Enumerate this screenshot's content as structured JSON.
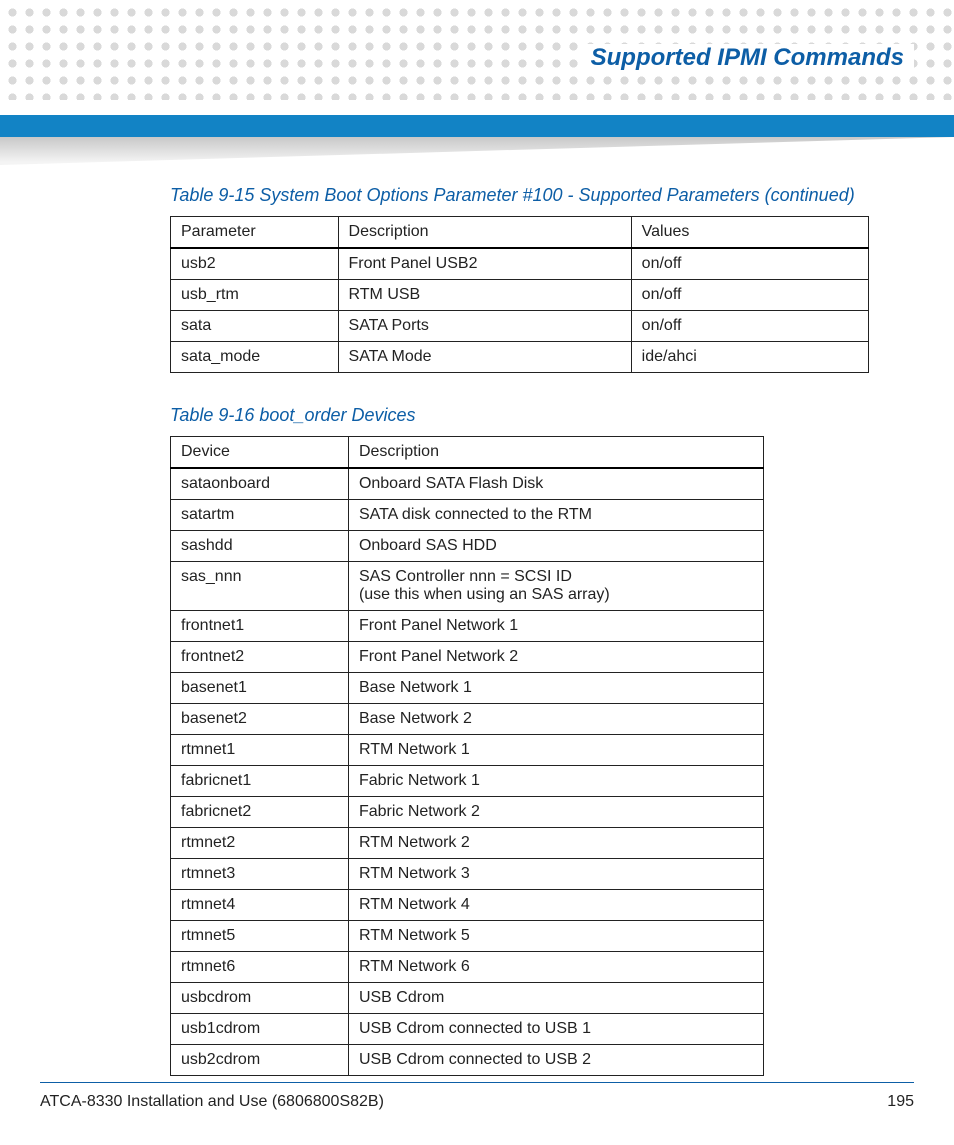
{
  "header": {
    "title": "Supported IPMI Commands"
  },
  "table_9_15": {
    "caption": "Table 9-15 System Boot Options Parameter #100 - Supported Parameters  (continued)",
    "headers": {
      "c0": "Parameter",
      "c1": "Description",
      "c2": "Values"
    },
    "rows": [
      {
        "c0": "usb2",
        "c1": "Front Panel USB2",
        "c2": "on/off"
      },
      {
        "c0": "usb_rtm",
        "c1": "RTM USB",
        "c2": "on/off"
      },
      {
        "c0": " sata",
        "c1": "SATA Ports",
        "c2": "on/off"
      },
      {
        "c0": "sata_mode",
        "c1": "SATA Mode",
        "c2": "ide/ahci"
      }
    ]
  },
  "table_9_16": {
    "caption": "Table 9-16 boot_order Devices",
    "headers": {
      "c0": "Device",
      "c1": "Description"
    },
    "rows": [
      {
        "c0": "sataonboard",
        "c1": "Onboard SATA Flash Disk"
      },
      {
        "c0": "satartm",
        "c1": "SATA disk connected to the RTM"
      },
      {
        "c0": "sashdd",
        "c1": "Onboard SAS HDD"
      },
      {
        "c0": "sas_nnn",
        "c1": "SAS Controller nnn = SCSI ID\n(use this when using an SAS array)"
      },
      {
        "c0": "frontnet1",
        "c1": "Front Panel Network 1"
      },
      {
        "c0": "frontnet2",
        "c1": "Front Panel Network 2"
      },
      {
        "c0": "basenet1",
        "c1": "Base Network 1"
      },
      {
        "c0": "basenet2",
        "c1": "Base Network 2"
      },
      {
        "c0": " rtmnet1",
        "c1": "RTM Network 1"
      },
      {
        "c0": "fabricnet1",
        "c1": "Fabric Network 1"
      },
      {
        "c0": "fabricnet2",
        "c1": "Fabric Network 2"
      },
      {
        "c0": "rtmnet2",
        "c1": "RTM Network 2"
      },
      {
        "c0": "rtmnet3",
        "c1": "RTM Network 3"
      },
      {
        "c0": "rtmnet4",
        "c1": "RTM Network 4"
      },
      {
        "c0": "rtmnet5",
        "c1": "RTM Network 5"
      },
      {
        "c0": "rtmnet6",
        "c1": "RTM Network 6"
      },
      {
        "c0": "usbcdrom",
        "c1": "USB Cdrom"
      },
      {
        "c0": "usb1cdrom",
        "c1": "USB Cdrom connected to USB 1"
      },
      {
        "c0": "usb2cdrom",
        "c1": "USB Cdrom connected to USB 2"
      }
    ]
  },
  "footer": {
    "doc": "ATCA-8330 Installation and Use (6806800S82B)",
    "page": "195"
  }
}
